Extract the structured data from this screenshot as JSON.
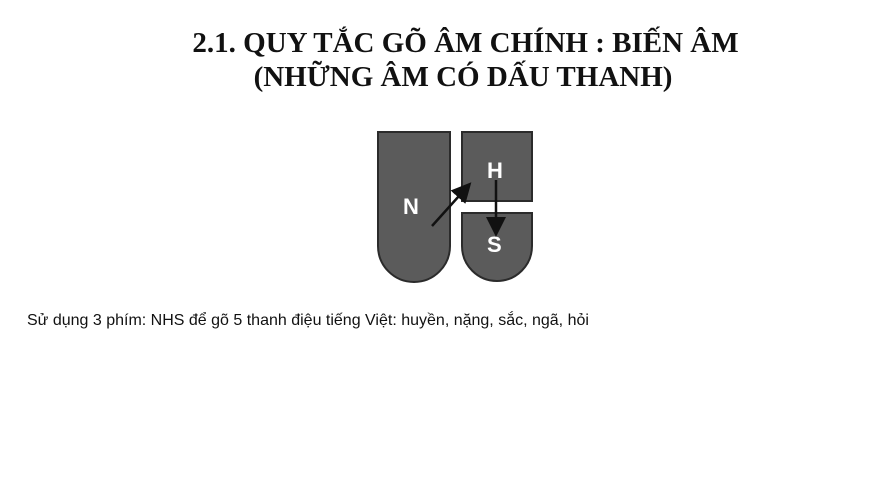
{
  "title": {
    "line1": "2.1. QUY TẮC GÕ ÂM CHÍNH : BIẾN ÂM",
    "line2": "(NHỮNG ÂM CÓ DẤU THANH)"
  },
  "diagram": {
    "keys": {
      "n": "N",
      "h": "H",
      "s": "S"
    },
    "key_color": "#5b5b5b",
    "border_color": "#2b2b2b",
    "arrow_color": "#111111"
  },
  "body": {
    "text": "Sử dụng 3 phím: NHS để gõ 5 thanh điệu tiếng Việt: huyền, nặng, sắc, ngã, hỏi"
  }
}
